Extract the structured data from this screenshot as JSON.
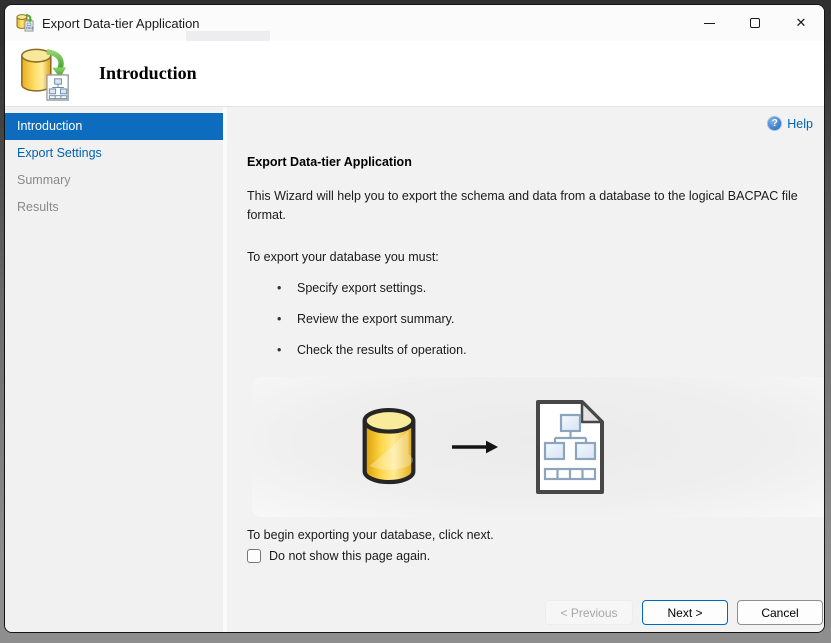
{
  "window": {
    "title": "Export Data-tier Application",
    "controls": {
      "close_glyph": "✕"
    }
  },
  "header": {
    "title": "Introduction"
  },
  "sidebar": {
    "items": [
      {
        "label": "Introduction",
        "state": "selected"
      },
      {
        "label": "Export Settings",
        "state": "link"
      },
      {
        "label": "Summary",
        "state": "disabled"
      },
      {
        "label": "Results",
        "state": "disabled"
      }
    ]
  },
  "content": {
    "help_label": "Help",
    "help_glyph": "?",
    "heading": "Export Data-tier Application",
    "intro": "This Wizard will help you to export the schema and data from a database to the logical BACPAC file format.",
    "list_intro": "To export your database you must:",
    "bullet_glyph": "•",
    "bullets": [
      "Specify export settings.",
      "Review the export summary.",
      "Check the results of operation."
    ],
    "footer_text": "To begin exporting your database, click next.",
    "checkbox_label": "Do not show this page again.",
    "checkbox_checked": false
  },
  "buttons": {
    "previous": "< Previous",
    "next": "Next >",
    "cancel": "Cancel"
  },
  "colors": {
    "nav_selected_bg": "#0d6cbd",
    "link_blue": "#0063b1",
    "next_button_border": "#0067c0",
    "disabled_text": "#8a8a8a",
    "database_yellow": "#f7cf43"
  }
}
